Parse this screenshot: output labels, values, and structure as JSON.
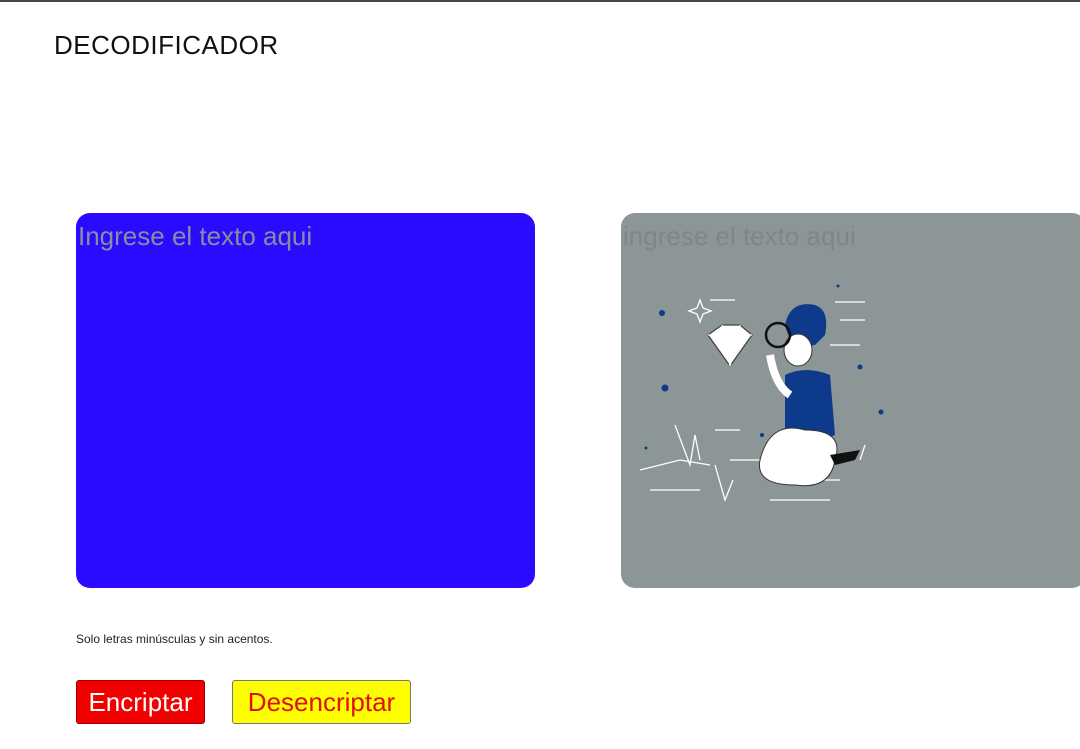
{
  "header": {
    "title": "DECODIFICADOR"
  },
  "input": {
    "placeholder": "Ingrese el texto aqui",
    "value": ""
  },
  "output": {
    "placeholder": "ingrese el texto aqui",
    "illustration": "person-magnifying-diamond-illustration"
  },
  "hint": "Solo letras minúsculas y sin acentos.",
  "buttons": {
    "encrypt": "Encriptar",
    "decrypt": "Desencriptar"
  },
  "colors": {
    "input_bg": "#2a0bff",
    "output_bg": "#8c9696",
    "encrypt_bg": "#f20000",
    "decrypt_bg": "#ffff00"
  }
}
